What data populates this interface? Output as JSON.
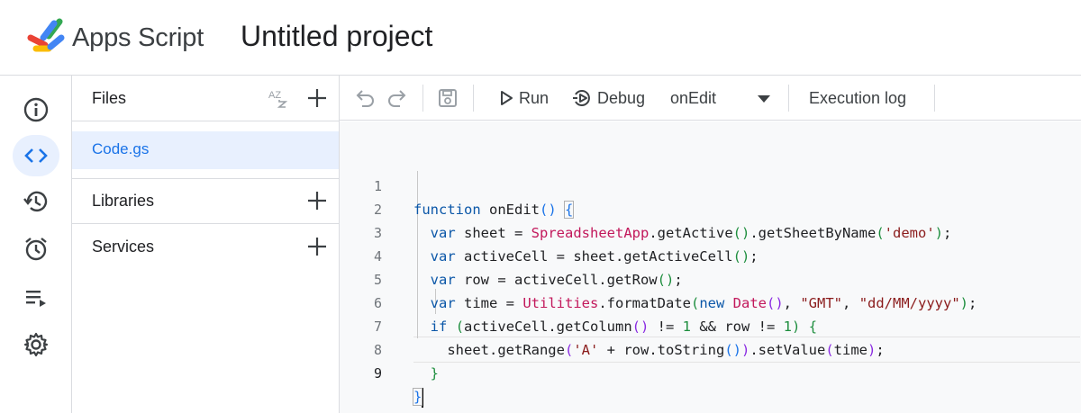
{
  "header": {
    "app_name": "Apps Script",
    "project_title": "Untitled project"
  },
  "rail": {
    "items": [
      {
        "icon": "info-icon"
      },
      {
        "icon": "code-icon",
        "active": true
      },
      {
        "icon": "history-icon"
      },
      {
        "icon": "alarm-icon"
      },
      {
        "icon": "executions-icon"
      },
      {
        "icon": "gear-icon"
      }
    ]
  },
  "files_panel": {
    "files_label": "Files",
    "sort_label": "AZ",
    "file_name": "Code.gs",
    "libraries_label": "Libraries",
    "services_label": "Services"
  },
  "toolbar": {
    "run_label": "Run",
    "debug_label": "Debug",
    "function_selected": "onEdit",
    "execution_log_label": "Execution log"
  },
  "editor": {
    "line_numbers": [
      "1",
      "2",
      "3",
      "4",
      "5",
      "6",
      "7",
      "8",
      "9"
    ],
    "current_line": 9
  },
  "colors": {
    "accent": "#1a73e8",
    "selected_bg": "#e8f0fe",
    "keyword": "#0b57a8",
    "class": "#c2185b",
    "string": "#8b1c1c",
    "number": "#1e8e3e"
  }
}
